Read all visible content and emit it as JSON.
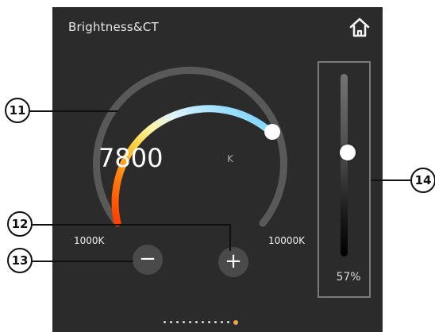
{
  "header": {
    "title": "Brightness&CT",
    "home_icon": "home-icon"
  },
  "dial": {
    "value": "7800",
    "unit": "K",
    "min_label": "1000K",
    "max_label": "10000K",
    "position_fraction": 0.75
  },
  "buttons": {
    "minus": "−",
    "plus": "+"
  },
  "brightness": {
    "percent_label": "57%",
    "level": 0.57
  },
  "pager": {
    "total": 12,
    "active_index": 11
  },
  "callouts": {
    "c11": "11",
    "c12": "12",
    "c13": "13",
    "c14": "14"
  },
  "colors": {
    "panel": "#2b2b2b",
    "accent_dot": "#f2a343",
    "arc_warm": "#ff4a00",
    "arc_yellow": "#fff06a",
    "arc_cool": "#72d3ff"
  }
}
